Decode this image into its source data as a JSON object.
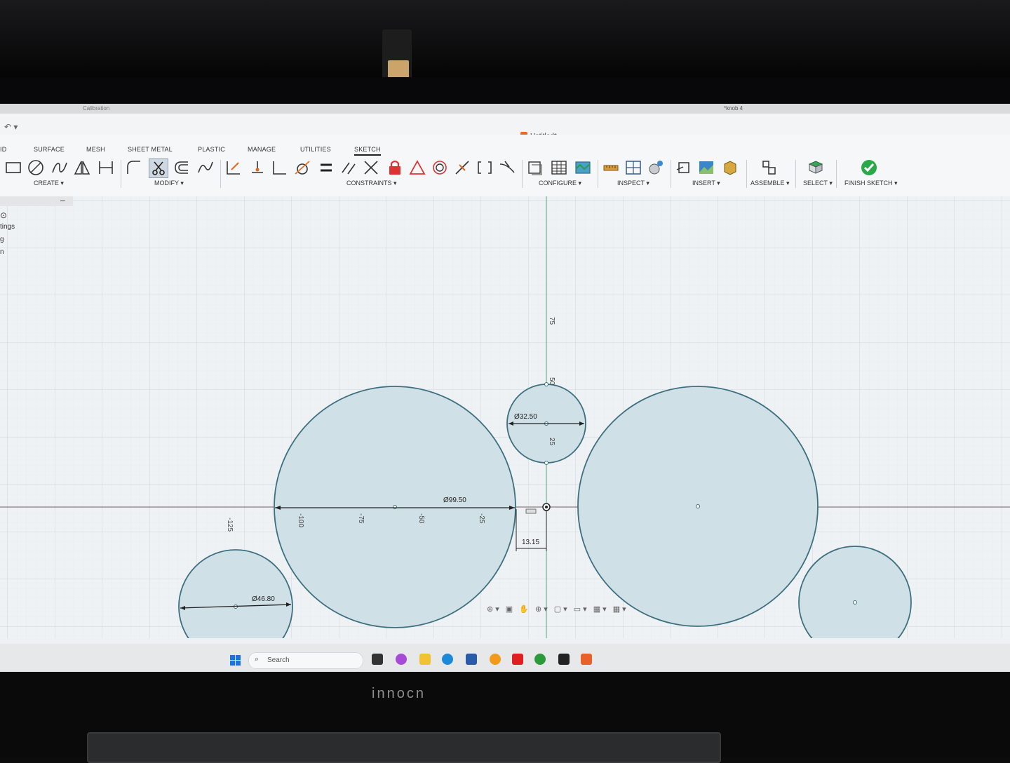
{
  "window": {
    "document_title": "*knob 4",
    "toolbar_recent": "Calibration"
  },
  "document_tab": {
    "label": "Untitled*"
  },
  "ribbon": {
    "tabs": [
      {
        "label": "ID"
      },
      {
        "label": "SURFACE"
      },
      {
        "label": "MESH"
      },
      {
        "label": "SHEET METAL"
      },
      {
        "label": "PLASTIC"
      },
      {
        "label": "MANAGE"
      },
      {
        "label": "UTILITIES"
      },
      {
        "label": "SKETCH",
        "active": true
      }
    ],
    "groups": {
      "create": "CREATE ▾",
      "modify": "MODIFY ▾",
      "constraints": "CONSTRAINTS ▾",
      "configure": "CONFIGURE ▾",
      "inspect": "INSPECT ▾",
      "insert": "INSERT ▾",
      "assemble": "ASSEMBLE ▾",
      "select": "SELECT ▾",
      "finish": "FINISH SKETCH ▾"
    }
  },
  "browser_panel": {
    "collapse": "–",
    "items": [
      "tings",
      "g",
      "n"
    ]
  },
  "sketch": {
    "dimensions": {
      "large_left_diameter": "Ø99.50",
      "small_top_diameter": "Ø32.50",
      "small_left_diameter": "Ø46.80",
      "offset": "13.15"
    },
    "x_ticks": [
      "-125",
      "-100",
      "-75",
      "-50",
      "-25"
    ],
    "y_ticks": [
      "75",
      "50",
      "25"
    ]
  },
  "taskbar": {
    "search_placeholder": "Search"
  },
  "monitor": {
    "brand": "innocn"
  },
  "colors": {
    "sketch_fill": "#cfe0e6",
    "sketch_stroke": "#3e6f80",
    "grid": "#dbe1e5",
    "finish_green": "#2aa84a"
  }
}
